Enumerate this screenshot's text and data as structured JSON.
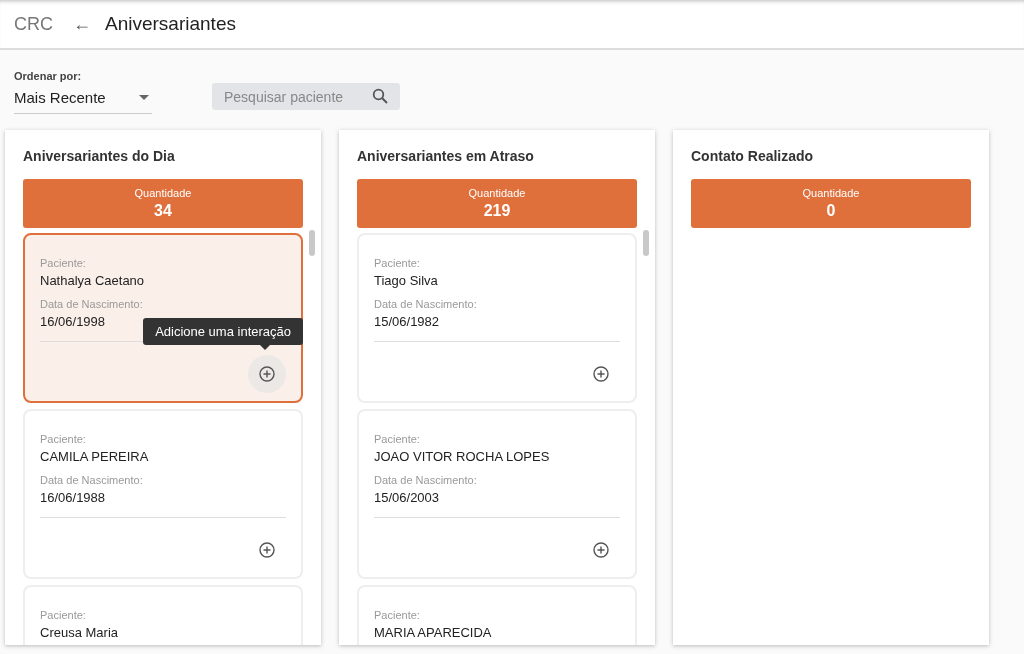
{
  "header": {
    "app": "CRC",
    "back_icon": "←",
    "title": "Aniversariantes"
  },
  "sort": {
    "label": "Ordenar por:",
    "value": "Mais Recente"
  },
  "search": {
    "placeholder": "Pesquisar paciente"
  },
  "columns": [
    {
      "title": "Aniversariantes do Dia",
      "count_label": "Quantidade",
      "count": "34",
      "cards": [
        {
          "patient_label": "Paciente:",
          "patient": "Nathalya Caetano",
          "birth_label": "Data de Nascimento:",
          "birth": "16/06/1998",
          "selected": true,
          "tooltip": "Adicione uma interação"
        },
        {
          "patient_label": "Paciente:",
          "patient": "CAMILA PEREIRA",
          "birth_label": "Data de Nascimento:",
          "birth": "16/06/1988",
          "selected": false
        },
        {
          "patient_label": "Paciente:",
          "patient": "Creusa Maria",
          "selected": false
        }
      ]
    },
    {
      "title": "Aniversariantes em Atraso",
      "count_label": "Quantidade",
      "count": "219",
      "cards": [
        {
          "patient_label": "Paciente:",
          "patient": "Tiago Silva",
          "birth_label": "Data de Nascimento:",
          "birth": "15/06/1982",
          "selected": false
        },
        {
          "patient_label": "Paciente:",
          "patient": "JOAO VITOR ROCHA LOPES",
          "birth_label": "Data de Nascimento:",
          "birth": "15/06/2003",
          "selected": false
        },
        {
          "patient_label": "Paciente:",
          "patient": "MARIA APARECIDA",
          "selected": false
        }
      ]
    },
    {
      "title": "Contato Realizado",
      "count_label": "Quantidade",
      "count": "0"
    }
  ]
}
